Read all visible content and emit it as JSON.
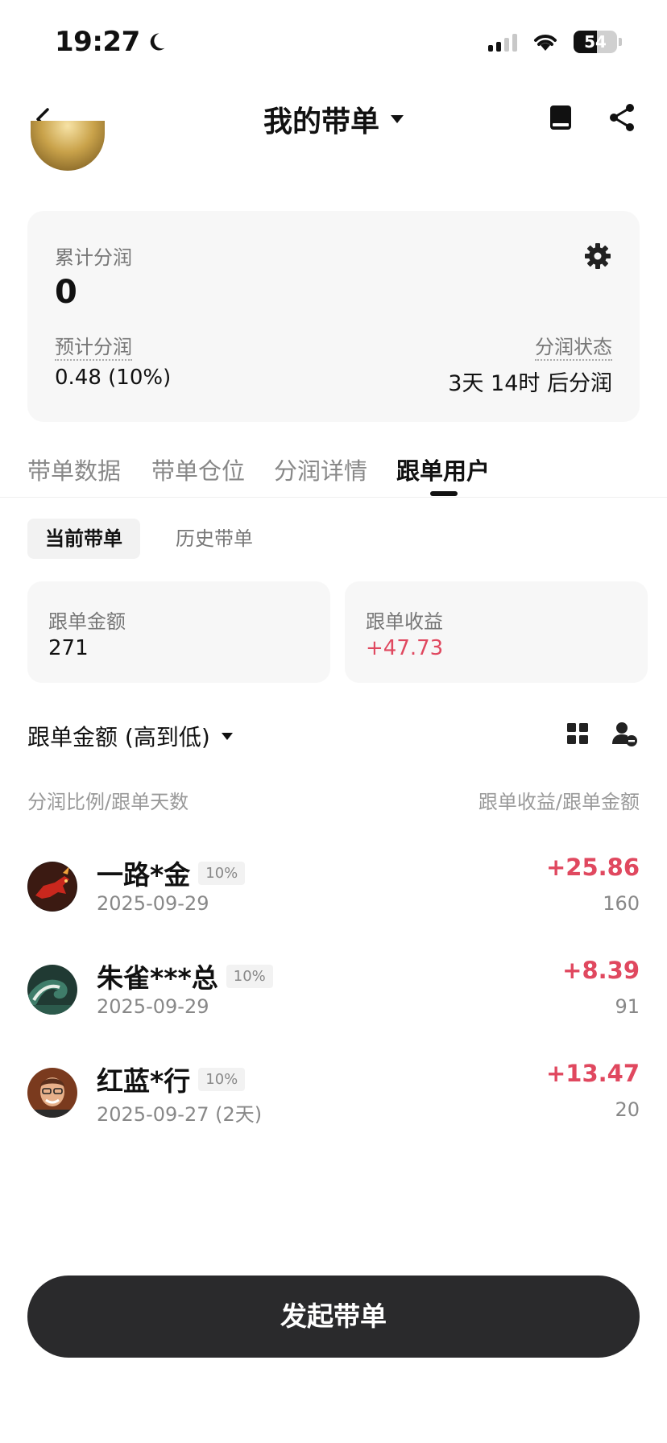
{
  "status_bar": {
    "time": "19:27",
    "battery": "54",
    "battery_fraction": 0.54
  },
  "header": {
    "title": "我的带单"
  },
  "summary": {
    "total_label": "累计分润",
    "total_value": "0",
    "estimated_label": "预计分润",
    "estimated_value": "0.48 (10%)",
    "status_label": "分润状态",
    "status_value": "3天 14时 后分润"
  },
  "tabs": [
    "带单数据",
    "带单仓位",
    "分润详情",
    "跟单用户"
  ],
  "active_tab": 3,
  "subtabs": [
    "当前带单",
    "历史带单"
  ],
  "metrics": [
    {
      "label": "跟单金额",
      "value": "271"
    },
    {
      "label": "跟单收益",
      "value": "+47.73"
    }
  ],
  "sort": {
    "label": "跟单金额 (高到低)"
  },
  "list_header": {
    "left": "分润比例/跟单天数",
    "right": "跟单收益/跟单金额"
  },
  "followers": [
    {
      "name": "一路*金",
      "ratio": "10%",
      "date": "2025-09-29",
      "profit": "+25.86",
      "amount": "160"
    },
    {
      "name": "朱雀***总",
      "ratio": "10%",
      "date": "2025-09-29",
      "profit": "+8.39",
      "amount": "91"
    },
    {
      "name": "红蓝*行",
      "ratio": "10%",
      "date": "2025-09-27 (2天)",
      "profit": "+13.47",
      "amount": "20"
    }
  ],
  "cta": {
    "label": "发起带单"
  },
  "colors": {
    "positive": "#e0485f",
    "button": "#2a2a2c",
    "card": "#f7f7f7"
  }
}
